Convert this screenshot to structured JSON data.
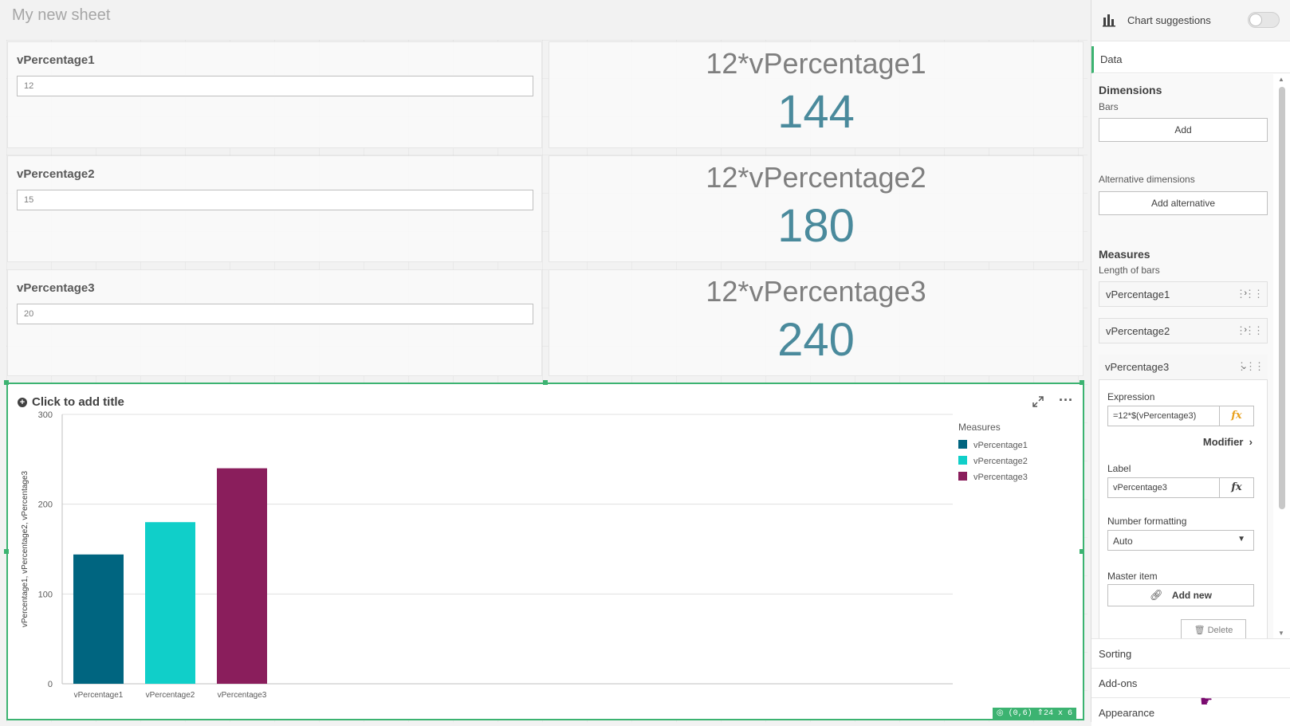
{
  "sheet": {
    "title": "My new sheet"
  },
  "variables": [
    {
      "name": "vPercentage1",
      "value": "12"
    },
    {
      "name": "vPercentage2",
      "value": "15"
    },
    {
      "name": "vPercentage3",
      "value": "20"
    }
  ],
  "kpis": [
    {
      "title": "12*vPercentage1",
      "value": "144"
    },
    {
      "title": "12*vPercentage2",
      "value": "180"
    },
    {
      "title": "12*vPercentage3",
      "value": "240"
    }
  ],
  "chart_object": {
    "title_placeholder": "Click to add title",
    "size_badge": "◎ (0,6) ⇑24 x 6",
    "expand_icon": "expand-icon",
    "menu_icon": "more-icon"
  },
  "chart_data": {
    "type": "bar",
    "categories": [
      "vPercentage1",
      "vPercentage2",
      "vPercentage3"
    ],
    "values": [
      144,
      180,
      240
    ],
    "colors": [
      "#006580",
      "#10cfc9",
      "#8a1e5c"
    ],
    "ylabel": "vPercentage1, vPercentage2, vPercentage3",
    "ylim": [
      0,
      300
    ],
    "yticks": [
      "0",
      "100",
      "200",
      "300"
    ],
    "legend_title": "Measures",
    "legend": [
      "vPercentage1",
      "vPercentage2",
      "vPercentage3"
    ],
    "legend_position": "right",
    "grid": true
  },
  "panel": {
    "chart_suggestions": "Chart suggestions",
    "tab_data": "Data",
    "dimensions_title": "Dimensions",
    "dimensions_sub": "Bars",
    "add_label": "Add",
    "alt_dimensions": "Alternative dimensions",
    "add_alternative": "Add alternative",
    "measures_title": "Measures",
    "measures_sub": "Length of bars",
    "measures": [
      "vPercentage1",
      "vPercentage2",
      "vPercentage3"
    ],
    "expression_label": "Expression",
    "expression_value": "=12*$(vPercentage3)",
    "modifier": "Modifier",
    "label_label": "Label",
    "label_value": "vPercentage3",
    "number_formatting": "Number formatting",
    "number_formatting_value": "Auto",
    "master_item": "Master item",
    "add_new": "Add new",
    "fx": "fx",
    "delete_partial": "Delete",
    "sorting": "Sorting",
    "addons": "Add-ons",
    "appearance": "Appearance"
  },
  "colors": {
    "accent": "#3cb371",
    "kpi": "#4a8a9c"
  }
}
